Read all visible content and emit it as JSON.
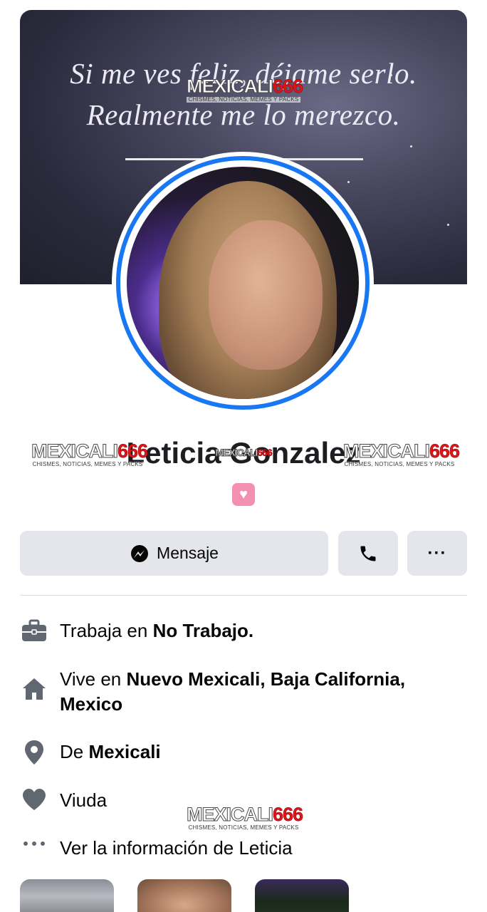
{
  "cover": {
    "quote_line1": "Si me ves feliz, déjame serlo.",
    "quote_line2": "Realmente me lo merezco."
  },
  "watermark": {
    "brand_a": "MEXICALI",
    "brand_b": "666",
    "tagline": "CHISMES, NOTICIAS, MEMES Y PACKS"
  },
  "profile": {
    "name": "Leticia Gonzalez",
    "badge_emoji": "♥"
  },
  "actions": {
    "message_label": "Mensaje",
    "more_label": "···"
  },
  "info": {
    "work_prefix": "Trabaja en ",
    "work_value": "No Trabajo.",
    "lives_prefix": "Vive en ",
    "lives_value": "Nuevo Mexicali, Baja California, Mexico",
    "from_prefix": "De ",
    "from_value": "Mexicali",
    "relationship": "Viuda",
    "see_more": "Ver la información de Leticia"
  },
  "colors": {
    "accent": "#1877f2",
    "button_bg": "#e4e6eb",
    "icon": "#606770"
  },
  "icons": {
    "work": "briefcase-icon",
    "home": "home-icon",
    "location": "location-pin-icon",
    "relationship": "heart-icon",
    "more": "more-dots-icon",
    "messenger": "messenger-icon",
    "phone": "phone-icon"
  }
}
